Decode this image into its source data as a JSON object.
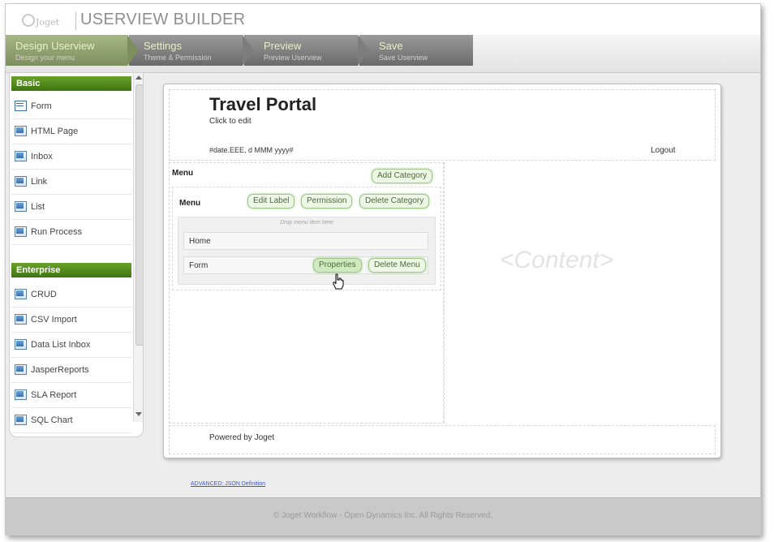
{
  "app": {
    "logo": "Joget",
    "title": "USERVIEW BUILDER"
  },
  "steps": [
    {
      "title": "Design Userview",
      "subtitle": "Design your menu"
    },
    {
      "title": "Settings",
      "subtitle": "Theme & Permission"
    },
    {
      "title": "Preview",
      "subtitle": "Preview Userview"
    },
    {
      "title": "Save",
      "subtitle": "Save Userview"
    }
  ],
  "palette": {
    "basic_label": "Basic",
    "basic_items": [
      "Form",
      "HTML Page",
      "Inbox",
      "Link",
      "List",
      "Run Process"
    ],
    "enterprise_label": "Enterprise",
    "enterprise_items": [
      "CRUD",
      "CSV Import",
      "Data List Inbox",
      "JasperReports",
      "SLA Report",
      "SQL Chart"
    ]
  },
  "canvas": {
    "title": "Travel Portal",
    "click_to_edit": "Click to edit",
    "date_format": "#date.EEE, d MMM yyyy#",
    "logout": "Logout",
    "menu_label": "Menu",
    "add_category": "Add Category",
    "category": {
      "name": "Menu",
      "edit_label": "Edit Label",
      "permission": "Permission",
      "delete_category": "Delete Category",
      "drop_hint": "Drop menu item here",
      "items": [
        "Home",
        "Form"
      ],
      "properties": "Properties",
      "delete_menu": "Delete Menu"
    },
    "content_placeholder": "<Content>",
    "powered_by": "Powered by Joget"
  },
  "advanced_link": "ADVANCED: JSON Definition",
  "footer": "© Joget Workflow - Open Dynamics Inc. All Rights Reserved."
}
